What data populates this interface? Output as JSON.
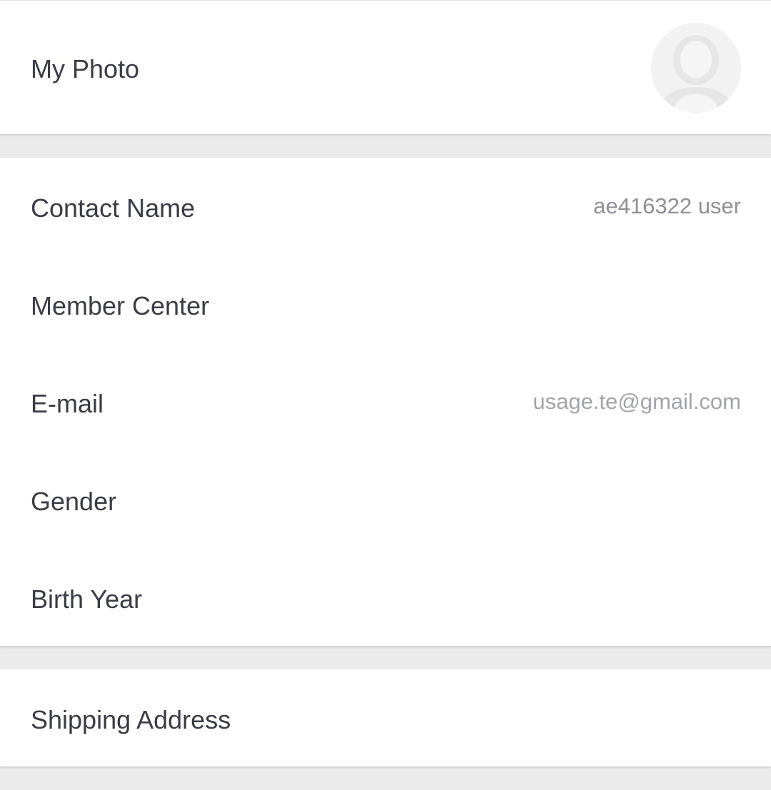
{
  "photo_section": {
    "label": "My Photo",
    "avatar_icon": "person-silhouette-icon"
  },
  "profile": {
    "contact_name": {
      "label": "Contact Name",
      "value": "ae416322 user"
    },
    "member_center": {
      "label": "Member Center"
    },
    "email": {
      "label": "E-mail",
      "value": "usage.te@gmail.com"
    },
    "gender": {
      "label": "Gender"
    },
    "birth_year": {
      "label": "Birth Year"
    }
  },
  "shipping": {
    "label": "Shipping Address"
  },
  "colors": {
    "background": "#ebebeb",
    "card": "#ffffff",
    "label_text": "#3b3c47",
    "value_text": "#8f9098"
  }
}
